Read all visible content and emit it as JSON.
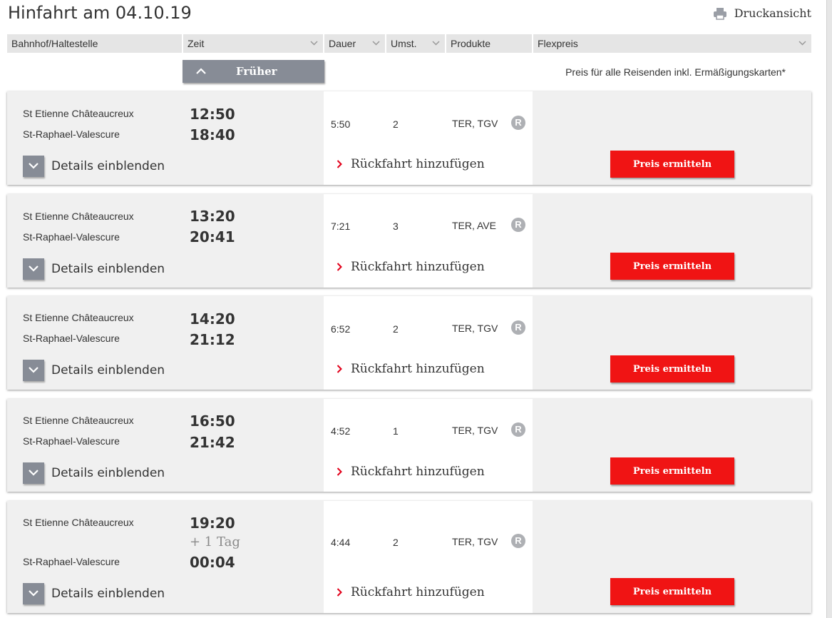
{
  "page": {
    "title": "Hinfahrt am 04.10.19",
    "print_label": "Druckansicht"
  },
  "columns": {
    "station": "Bahnhof/Haltestelle",
    "time": "Zeit",
    "duration": "Dauer",
    "changes": "Umst.",
    "products": "Produkte",
    "price": "Flexpreis"
  },
  "earlier_label": "Früher",
  "price_note": "Preis für alle Reisenden inkl. Ermäßigungskarten*",
  "connections": [
    {
      "from": "St Etienne Châteaucreux",
      "to": "St-Raphael-Valescure",
      "dep": "12:50",
      "arr": "18:40",
      "next_day": "",
      "duration": "5:50",
      "changes": "2",
      "products": "TER, TGV",
      "badge": "R",
      "details": "Details einblenden",
      "return": "Rückfahrt hinzufügen",
      "price_button": "Preis ermitteln"
    },
    {
      "from": "St Etienne Châteaucreux",
      "to": "St-Raphael-Valescure",
      "dep": "13:20",
      "arr": "20:41",
      "next_day": "",
      "duration": "7:21",
      "changes": "3",
      "products": "TER, AVE",
      "badge": "R",
      "details": "Details einblenden",
      "return": "Rückfahrt hinzufügen",
      "price_button": "Preis ermitteln"
    },
    {
      "from": "St Etienne Châteaucreux",
      "to": "St-Raphael-Valescure",
      "dep": "14:20",
      "arr": "21:12",
      "next_day": "",
      "duration": "6:52",
      "changes": "2",
      "products": "TER, TGV",
      "badge": "R",
      "details": "Details einblenden",
      "return": "Rückfahrt hinzufügen",
      "price_button": "Preis ermitteln"
    },
    {
      "from": "St Etienne Châteaucreux",
      "to": "St-Raphael-Valescure",
      "dep": "16:50",
      "arr": "21:42",
      "next_day": "",
      "duration": "4:52",
      "changes": "1",
      "products": "TER, TGV",
      "badge": "R",
      "details": "Details einblenden",
      "return": "Rückfahrt hinzufügen",
      "price_button": "Preis ermitteln"
    },
    {
      "from": "St Etienne Châteaucreux",
      "to": "St-Raphael-Valescure",
      "dep": "19:20",
      "arr": "00:04",
      "next_day": "+ 1 Tag",
      "duration": "4:44",
      "changes": "2",
      "products": "TER, TGV",
      "badge": "R",
      "details": "Details einblenden",
      "return": "Rückfahrt hinzufügen",
      "price_button": "Preis ermitteln"
    }
  ],
  "colors": {
    "accent_red": "#f01414",
    "button_gray": "#878c96",
    "header_gray": "#e5e5e5",
    "row_gray": "#f0f0f0"
  }
}
